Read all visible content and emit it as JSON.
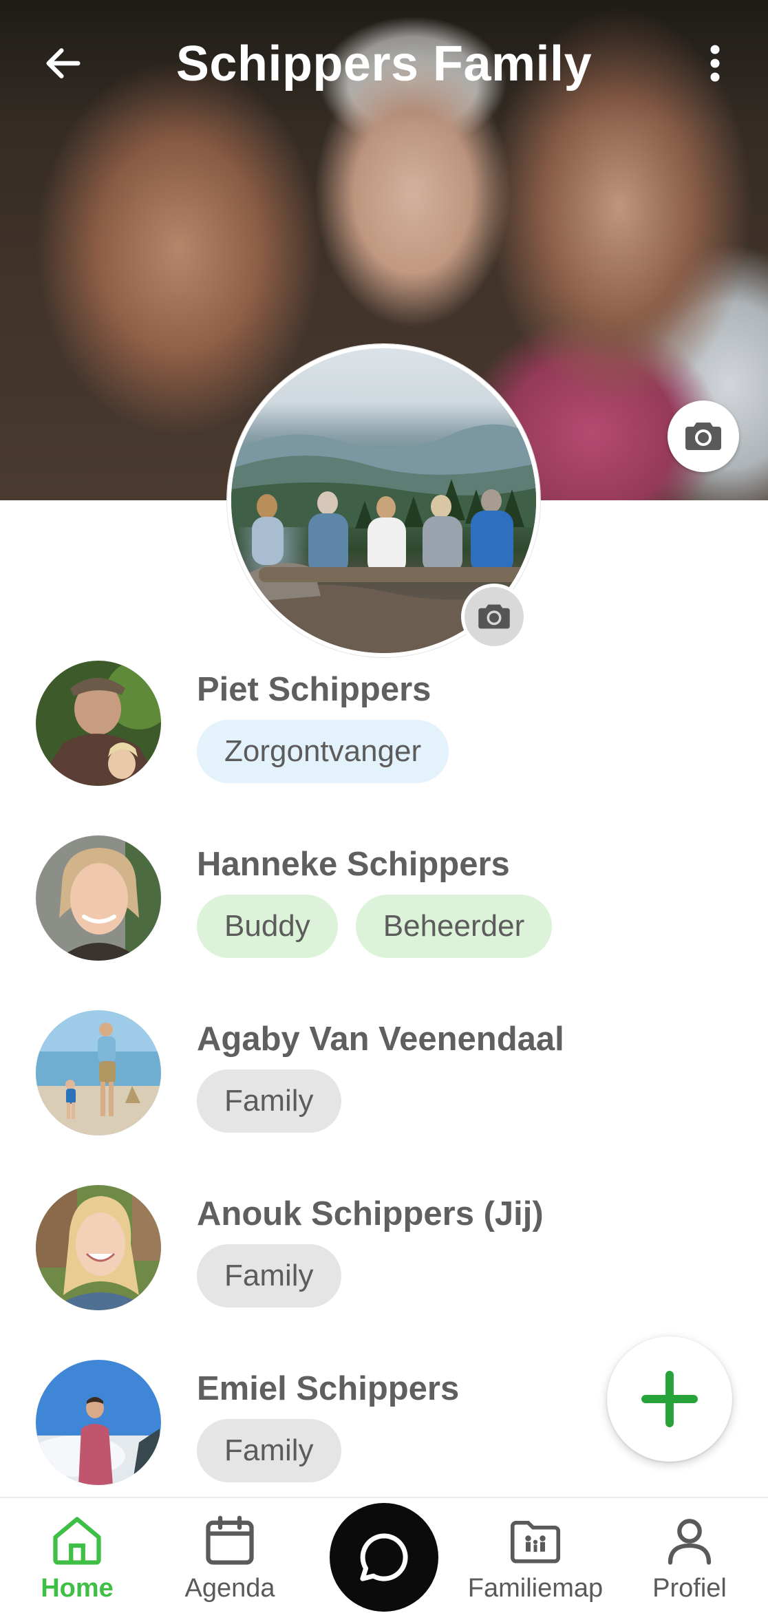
{
  "header": {
    "title": "Schippers Family",
    "back_icon": "arrow-left-icon",
    "more_icon": "more-vertical-icon"
  },
  "cover": {
    "camera_icon": "camera-icon"
  },
  "group_avatar": {
    "camera_icon": "camera-icon"
  },
  "members": [
    {
      "name": "Piet Schippers",
      "tags": [
        {
          "label": "Zorgontvanger",
          "style": "blue"
        }
      ]
    },
    {
      "name": "Hanneke Schippers",
      "tags": [
        {
          "label": "Buddy",
          "style": "green"
        },
        {
          "label": "Beheerder",
          "style": "green"
        }
      ]
    },
    {
      "name": "Agaby Van Veenendaal",
      "tags": [
        {
          "label": "Family",
          "style": "grey"
        }
      ]
    },
    {
      "name": "Anouk Schippers (Jij)",
      "tags": [
        {
          "label": "Family",
          "style": "grey"
        }
      ]
    },
    {
      "name": "Emiel Schippers",
      "tags": [
        {
          "label": "Family",
          "style": "grey"
        }
      ]
    }
  ],
  "fab": {
    "icon": "plus-icon"
  },
  "bottom_nav": {
    "items": [
      {
        "label": "Home",
        "icon": "home-icon",
        "active": true
      },
      {
        "label": "Agenda",
        "icon": "calendar-icon",
        "active": false
      },
      {
        "label": "Familiemap",
        "icon": "family-folder-icon",
        "active": false
      },
      {
        "label": "Profiel",
        "icon": "user-icon",
        "active": false
      }
    ],
    "chat_icon": "chat-bubble-icon"
  },
  "colors": {
    "accent_green": "#3fbf45",
    "fab_plus": "#27a33a",
    "tag_blue": "#e3f2fb",
    "tag_green": "#dcf3d9",
    "tag_grey": "#e5e5e5"
  }
}
